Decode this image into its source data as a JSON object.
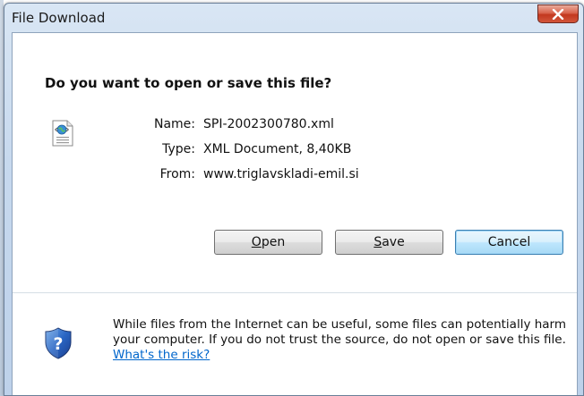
{
  "window": {
    "title": "File Download",
    "close_icon": "close-icon"
  },
  "dialog": {
    "question": "Do you want to open or save this file?",
    "file_icon": "xml-document-icon",
    "fields": [
      {
        "label": "Name:",
        "value": "SPI-2002300780.xml"
      },
      {
        "label": "Type:",
        "value": "XML Document, 8,40KB"
      },
      {
        "label": "From:",
        "value": "www.triglavskladi-emil.si"
      }
    ],
    "buttons": {
      "open_first": "O",
      "open_rest": "pen",
      "save_first": "S",
      "save_rest": "ave",
      "cancel": "Cancel"
    },
    "warning": {
      "icon": "security-shield-icon",
      "text": "While files from the Internet can be useful, some files can potentially harm your computer. If you do not trust the source, do not open or save this file. ",
      "link": "What's the risk?"
    }
  },
  "colors": {
    "title_bar": "#c7d9ee",
    "close_button": "#c2381f",
    "default_button": "#bee6fd",
    "link": "#0066cc"
  }
}
